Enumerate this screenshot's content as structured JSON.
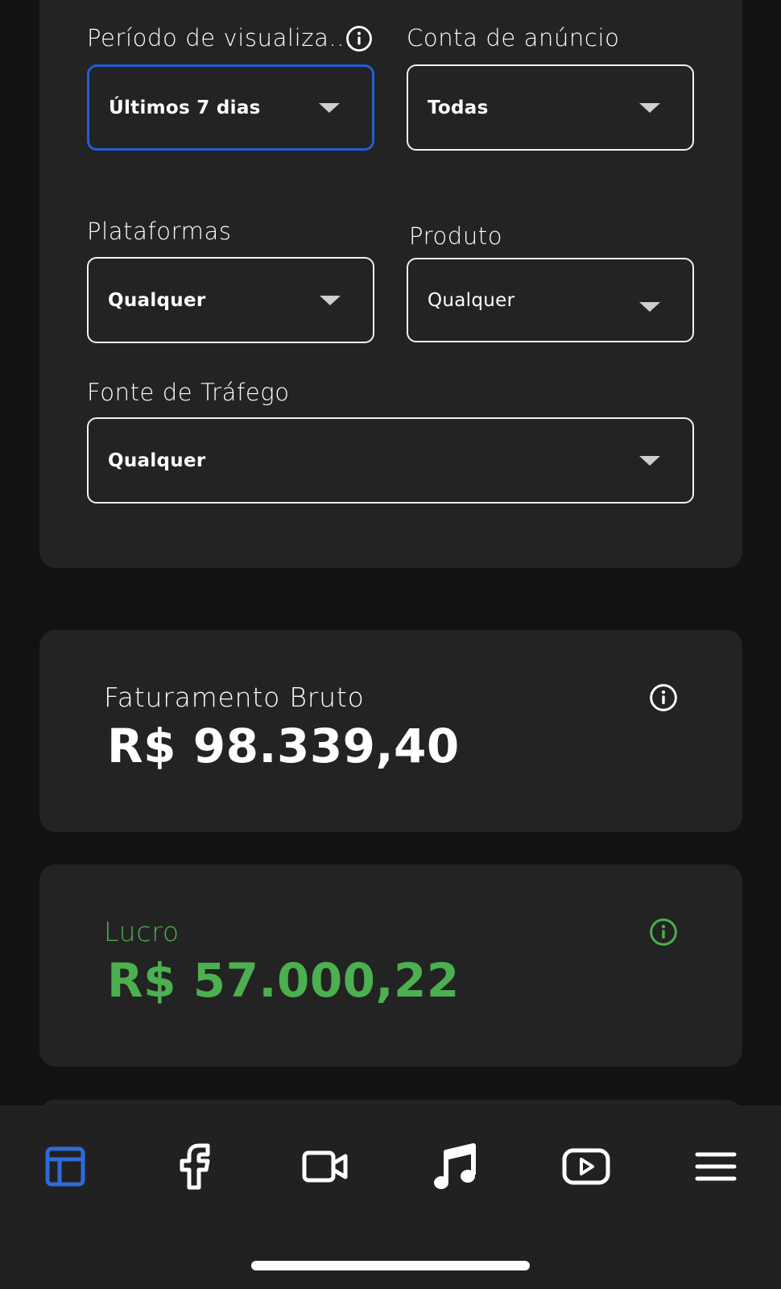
{
  "filters": {
    "period": {
      "label": "Período de visualiza...",
      "value": "Últimos 7 dias"
    },
    "ad_account": {
      "label": "Conta de anúncio",
      "value": "Todas"
    },
    "platforms": {
      "label": "Plataformas",
      "value": "Qualquer"
    },
    "product": {
      "label": "Produto",
      "value": "Qualquer"
    },
    "traffic_source": {
      "label": "Fonte de Tráfego",
      "value": "Qualquer"
    }
  },
  "metrics": {
    "gross_revenue": {
      "label": "Faturamento Bruto",
      "value": "R$ 98.339,40",
      "color": "#ffffff"
    },
    "profit": {
      "label": "Lucro",
      "value": "R$ 57.000,22",
      "color": "#4caf50"
    }
  },
  "tabbar": {
    "items": [
      {
        "icon": "dashboard-icon",
        "active": true
      },
      {
        "icon": "facebook-icon",
        "active": false
      },
      {
        "icon": "video-camera-icon",
        "active": false
      },
      {
        "icon": "music-note-icon",
        "active": false
      },
      {
        "icon": "youtube-icon",
        "active": false
      },
      {
        "icon": "menu-icon",
        "active": false
      }
    ],
    "active_color": "#2f6bd8"
  }
}
